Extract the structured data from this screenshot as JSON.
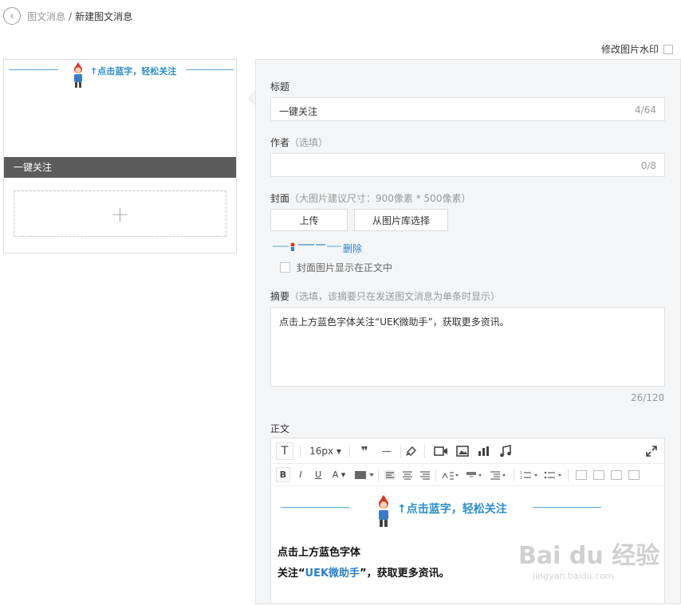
{
  "breadcrumb": {
    "parent": "图文消息",
    "separator": "/",
    "current": "新建图文消息"
  },
  "watermark_toggle": {
    "label": "修改图片水印"
  },
  "preview": {
    "slogan": "↑点击蓝字，轻松关注",
    "article_title": "一键关注",
    "add_symbol": "+"
  },
  "form": {
    "title": {
      "label": "标题",
      "value": "一键关注",
      "counter": "4/64"
    },
    "author": {
      "label": "作者",
      "hint": "（选填）",
      "value": "",
      "counter": "0/8"
    },
    "cover": {
      "label": "封面",
      "hint": "（大图片建议尺寸：900像素 * 500像素）",
      "upload_button": "上传",
      "library_button": "从图片库选择",
      "delete_link": "删除",
      "show_in_body_label": "封面图片显示在正文中"
    },
    "summary": {
      "label": "摘要",
      "hint": "（选填，该摘要只在发送图文消息为单条时显示）",
      "value": "点击上方蓝色字体关注“UEK微助手”，获取更多资讯。",
      "counter": "26/120"
    },
    "body": {
      "label": "正文"
    }
  },
  "editor": {
    "toolbar": {
      "text_icon": "T",
      "font_size": "16px ▾",
      "quote_icon": "❞",
      "hr_icon": "—",
      "bold": "B",
      "italic": "I",
      "underline": "U",
      "font_color": "A ▾"
    },
    "content": {
      "slogan": "↑点击蓝字，轻松关注",
      "line1": "点击上方蓝色字体",
      "line2_prefix": "关注“",
      "line2_link": "UEK微助手",
      "line2_suffix": "”，获取更多资讯。"
    }
  },
  "overlay_watermark": {
    "brand": "Bai du 经验",
    "sub": "jingyan.baidu.com"
  }
}
